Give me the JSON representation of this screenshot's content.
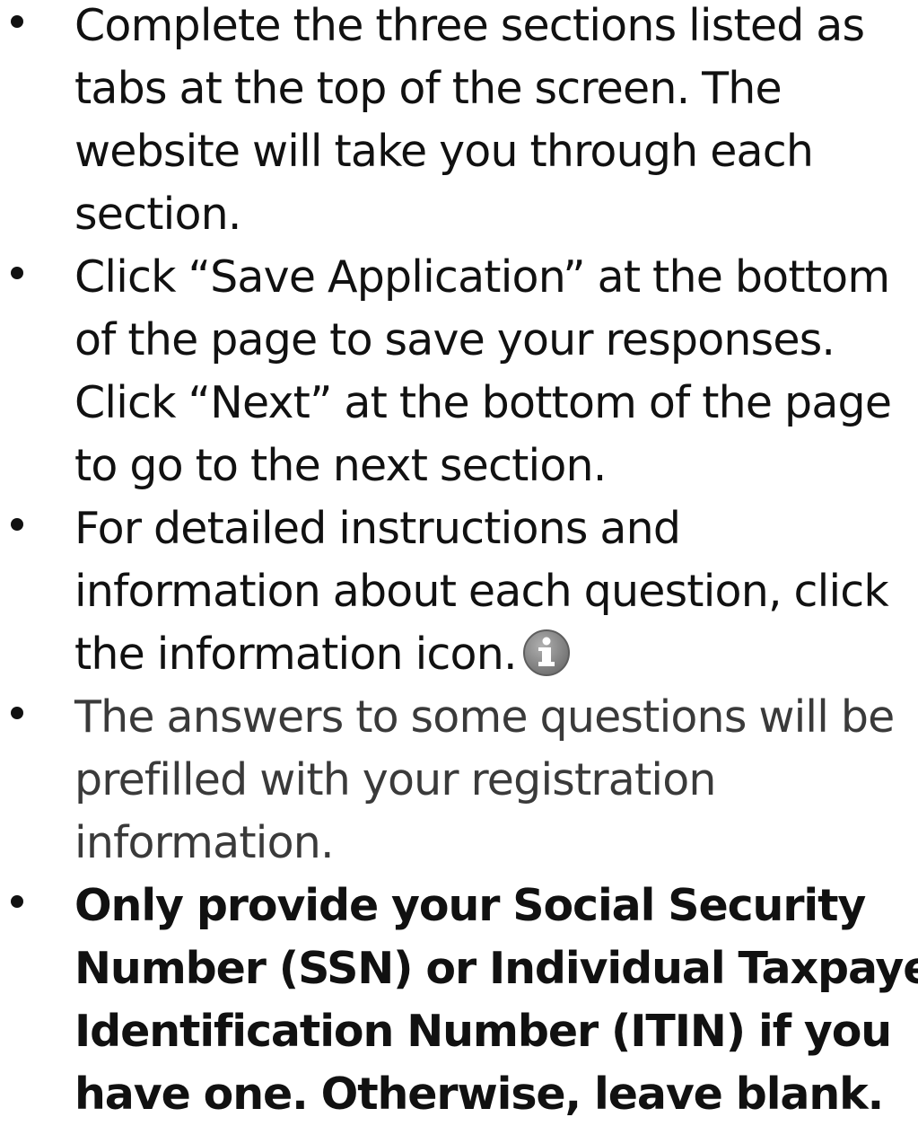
{
  "instructions": {
    "items": [
      {
        "lines": [
          "Complete the three sections listed as",
          "tabs at the top of the screen. The",
          "website will take you through each",
          "section."
        ]
      },
      {
        "lines": [
          "Click “Save Application” at the bottom",
          "of the page to save your responses.",
          "Click “Next” at the bottom of the page",
          "to go to the next section."
        ]
      },
      {
        "lines": [
          "For detailed instructions and",
          "information about each question, click",
          "the information icon."
        ],
        "icon": "info-icon"
      },
      {
        "lines": [
          "The answers to some questions will be",
          "prefilled with your registration",
          "information."
        ]
      },
      {
        "lines": [
          "Only provide your Social Security",
          "Number (SSN) or Individual Taxpayer",
          "Identification Number (ITIN) if you",
          "have one. Otherwise, leave blank."
        ]
      }
    ]
  },
  "colors": {
    "text": "#111111",
    "muted_text": "#3a3a3a",
    "icon_fill": "#8a8a8a",
    "background": "#ffffff"
  }
}
